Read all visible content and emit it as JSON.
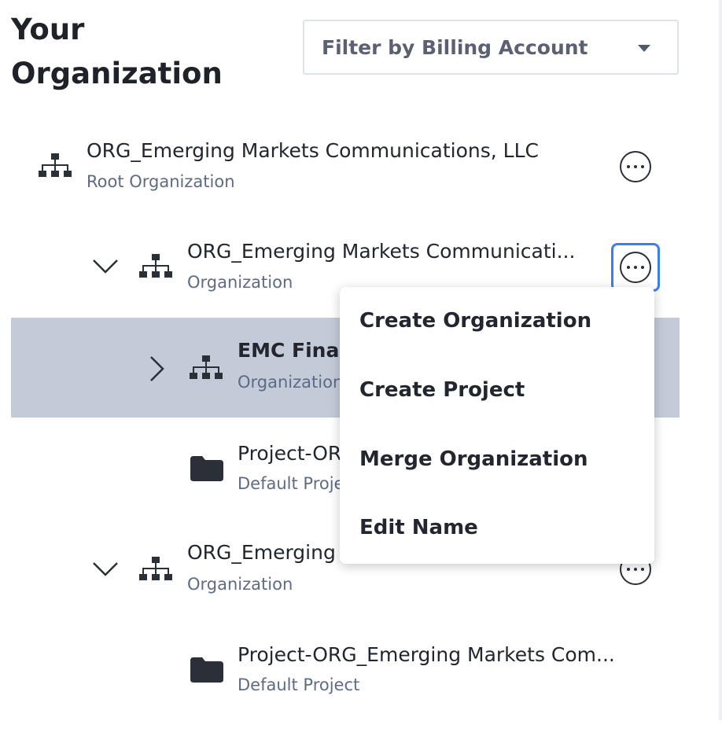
{
  "header": {
    "title": "Your Organization",
    "filter_label": "Filter by Billing Account"
  },
  "tree": [
    {
      "name": "ORG_Emerging Markets Communications, LLC",
      "type": "Root Organization"
    },
    {
      "name": "ORG_Emerging Markets Communicati...",
      "type": "Organization"
    },
    {
      "name": "EMC Financial",
      "type": "Organization"
    },
    {
      "name": "Project-ORG",
      "type": "Default Project"
    },
    {
      "name": "ORG_Emerging",
      "type": "Organization"
    },
    {
      "name": "Project-ORG_Emerging Markets Com...",
      "type": "Default Project"
    }
  ],
  "context_menu": {
    "items": [
      "Create Organization",
      "Create Project",
      "Merge Organization",
      "Edit Name"
    ]
  },
  "colors": {
    "selected_row": "#c3cad8",
    "focus_ring": "#3b7fe8",
    "subtitle": "#5e6b85"
  }
}
